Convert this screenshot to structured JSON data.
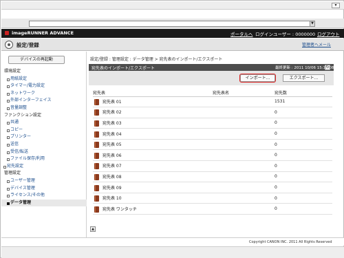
{
  "brand": {
    "name": "imageRUNNER ADVANCE",
    "portal_link": "ポータルへ",
    "user_label": "ログインユーザー : 0000000",
    "logout_link": "ログアウト"
  },
  "header": {
    "title": "設定/登録",
    "admin_link": "管理者へメール"
  },
  "sidebar": {
    "restart_button": "デバイスの再起動",
    "sections": [
      {
        "label": "環境設定",
        "items": [
          "用紙設定",
          "タイマー/電力設定",
          "ネットワーク",
          "外部インターフェイス",
          "音量調整"
        ]
      },
      {
        "label": "ファンクション設定",
        "items": [
          "共通",
          "コピー",
          "プリンター",
          "送信",
          "受信/転送",
          "ファイル保存/利用"
        ]
      }
    ],
    "top_item": "宛先設定",
    "admin_section": {
      "label": "管理設定",
      "items": [
        "ユーザー管理",
        "デバイス管理",
        "ライセンス/その他",
        "データ管理"
      ]
    }
  },
  "main": {
    "breadcrumb": "設定/登録 : 管理設定 : データ管理 > 宛先表のインポート/エクスポート",
    "panel_title": "宛先表のインポート/エクスポート",
    "last_updated": "最終更新 : 2011 10/06 15:14:08",
    "import_button": "インポート...",
    "export_button": "エクスポート...",
    "table": {
      "headers": [
        "宛先表",
        "宛先表名",
        "宛先数"
      ],
      "rows": [
        {
          "name": "宛先表 01",
          "label": "",
          "count": "1531"
        },
        {
          "name": "宛先表 02",
          "label": "",
          "count": "0"
        },
        {
          "name": "宛先表 03",
          "label": "",
          "count": "0"
        },
        {
          "name": "宛先表 04",
          "label": "",
          "count": "0"
        },
        {
          "name": "宛先表 05",
          "label": "",
          "count": "0"
        },
        {
          "name": "宛先表 06",
          "label": "",
          "count": "0"
        },
        {
          "name": "宛先表 07",
          "label": "",
          "count": "0"
        },
        {
          "name": "宛先表 08",
          "label": "",
          "count": "0"
        },
        {
          "name": "宛先表 09",
          "label": "",
          "count": "0"
        },
        {
          "name": "宛先表 10",
          "label": "",
          "count": "0"
        },
        {
          "name": "宛先表 ワンタッチ",
          "label": "",
          "count": "0"
        }
      ]
    }
  },
  "footer": {
    "copyright": "Copyright CANON INC. 2011 All Rights Reserved"
  },
  "colors": {
    "accent_link": "#1a4c8c",
    "header_bg": "#1a1a1a",
    "highlight": "#d22222"
  }
}
